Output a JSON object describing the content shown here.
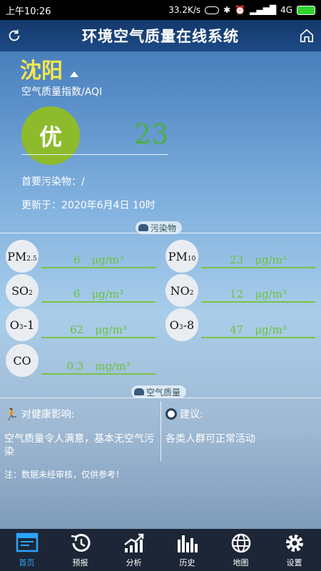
{
  "status_bar": {
    "time": "上午10:26",
    "network_speed": "33.2K/s",
    "signal": "4G"
  },
  "header": {
    "title": "环境空气质量在线系统"
  },
  "city": {
    "name": "沈阳"
  },
  "aqi": {
    "label": "空气质量指数/AQI",
    "level": "优",
    "value": "23",
    "primary_pollutant": "首要污染物：/",
    "updated": "更新于：2020年6月4日 10时",
    "level_color": "#8dbb2c",
    "value_color": "#4caf43"
  },
  "sections": {
    "pollutants": "污染物",
    "air_quality": "空气质量"
  },
  "pollutants": [
    {
      "name": "PM",
      "sub": "2.5",
      "value": "6",
      "unit": "μg/m³"
    },
    {
      "name": "PM",
      "sub": "10",
      "value": "23",
      "unit": "μg/m³"
    },
    {
      "name": "SO",
      "sub": "2",
      "value": "6",
      "unit": "μg/m³"
    },
    {
      "name": "NO",
      "sub": "2",
      "value": "12",
      "unit": "μg/m³"
    },
    {
      "name": "O",
      "sub": "3",
      "suffix": "-1",
      "value": "62",
      "unit": "μg/m³"
    },
    {
      "name": "O",
      "sub": "3",
      "suffix": "-8",
      "value": "47",
      "unit": "μg/m³"
    },
    {
      "name": "CO",
      "sub": "",
      "value": "0.3",
      "unit": "mg/m³"
    }
  ],
  "health": {
    "title": "对健康影响:",
    "text": "空气质量令人满意，基本无空气污染"
  },
  "advice": {
    "title": "建议:",
    "text": "各类人群可正常活动"
  },
  "note": "注：数据未经审核，仅供参考！",
  "nav": [
    {
      "label": "首页",
      "icon": "home-screen-icon"
    },
    {
      "label": "预报",
      "icon": "forecast-history-icon"
    },
    {
      "label": "分析",
      "icon": "analysis-chart-icon"
    },
    {
      "label": "历史",
      "icon": "history-bars-icon"
    },
    {
      "label": "地图",
      "icon": "globe-map-icon"
    },
    {
      "label": "设置",
      "icon": "gear-icon"
    }
  ]
}
